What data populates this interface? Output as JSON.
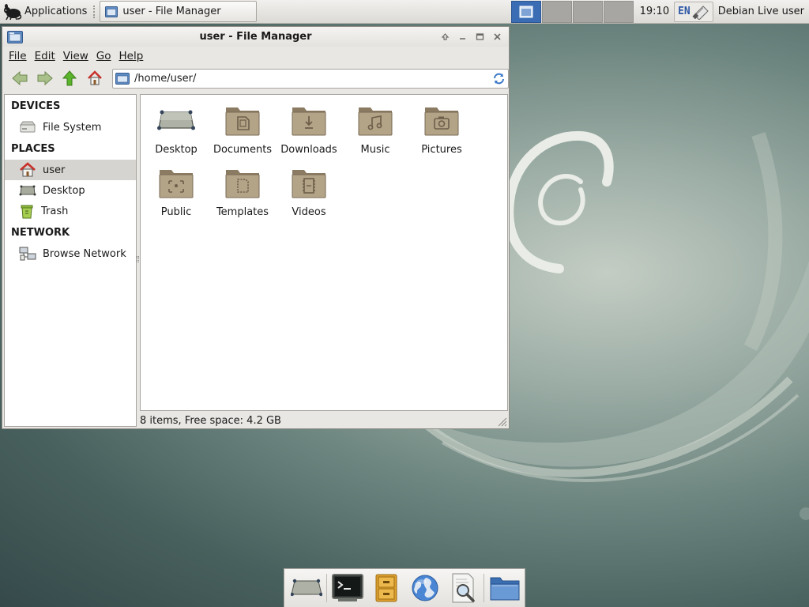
{
  "top_panel": {
    "applications_label": "Applications",
    "task_title": "user - File Manager",
    "clock": "19:10",
    "keyboard_layout": "EN",
    "user_name": "Debian Live user"
  },
  "window": {
    "title": "user - File Manager",
    "menu": {
      "file": "File",
      "edit": "Edit",
      "view": "View",
      "go": "Go",
      "help": "Help"
    },
    "location_path": "/home/user/",
    "sidebar": {
      "devices_heading": "DEVICES",
      "file_system": "File System",
      "places_heading": "PLACES",
      "user": "user",
      "desktop": "Desktop",
      "trash": "Trash",
      "network_heading": "NETWORK",
      "browse_network": "Browse Network"
    },
    "files": [
      {
        "name": "Desktop",
        "icon": "desktop-icon"
      },
      {
        "name": "Documents",
        "icon": "folder-documents-icon"
      },
      {
        "name": "Downloads",
        "icon": "folder-downloads-icon"
      },
      {
        "name": "Music",
        "icon": "folder-music-icon"
      },
      {
        "name": "Pictures",
        "icon": "folder-pictures-icon"
      },
      {
        "name": "Public",
        "icon": "folder-public-icon"
      },
      {
        "name": "Templates",
        "icon": "folder-templates-icon"
      },
      {
        "name": "Videos",
        "icon": "folder-videos-icon"
      }
    ],
    "status": "8 items, Free space: 4.2 GB"
  },
  "dock": {
    "items": [
      "show-desktop-icon",
      "terminal-icon",
      "file-cabinet-icon",
      "web-browser-icon",
      "search-icon",
      "folder-icon"
    ]
  },
  "colors": {
    "folder": "#8b7b62",
    "folder_light": "#b3a387",
    "selection": "#d6d4d0",
    "workspace_active": "#3b6db4",
    "keyboard_text": "#2c56a6"
  }
}
